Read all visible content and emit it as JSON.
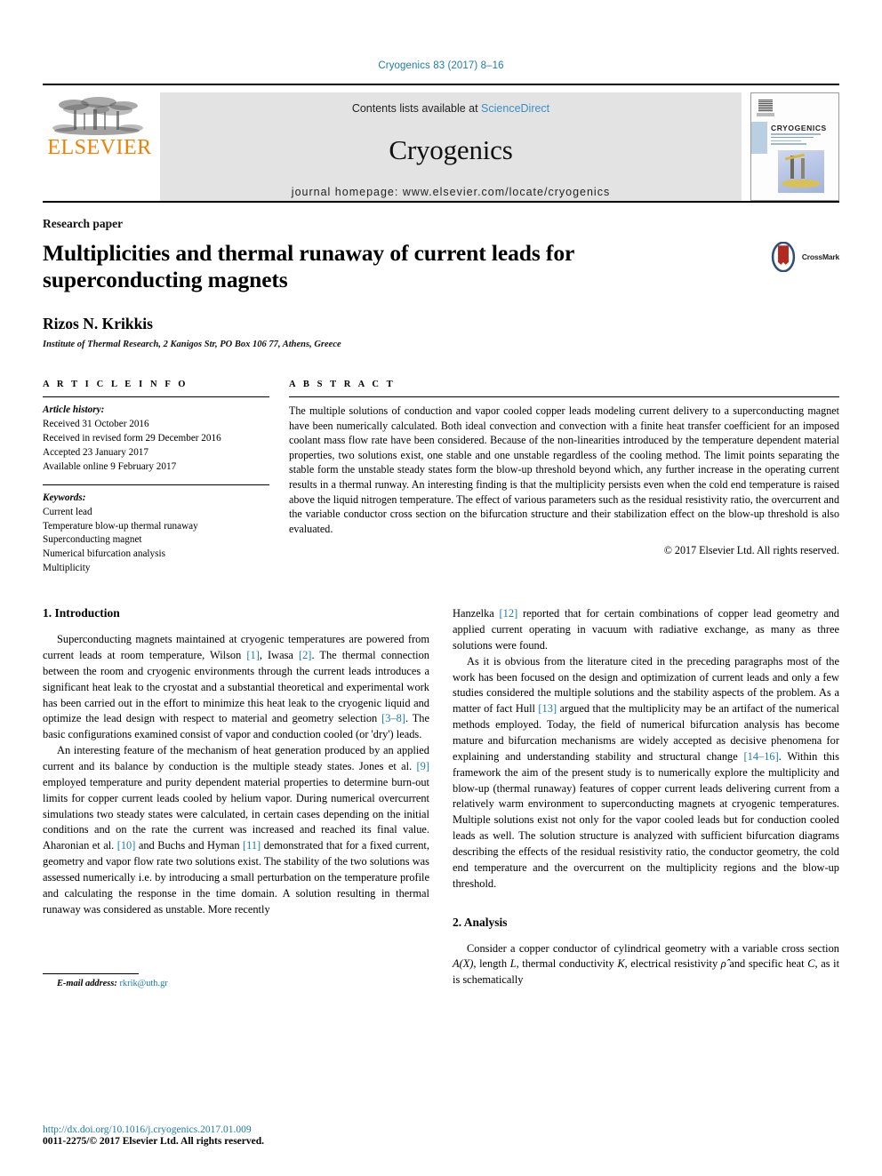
{
  "running_head": "Cryogenics 83 (2017) 8–16",
  "masthead": {
    "publisher": "ELSEVIER",
    "contents_prefix": "Contents lists available at ",
    "contents_link": "ScienceDirect",
    "journal_title": "Cryogenics",
    "homepage": "journal homepage: www.elsevier.com/locate/cryogenics",
    "cover_name": "CRYOGENICS"
  },
  "article": {
    "kicker": "Research paper",
    "title": "Multiplicities and thermal runaway of current leads for superconducting magnets",
    "crossmark_label": "CrossMark",
    "author": "Rizos N. Krikkis",
    "affiliation": "Institute of Thermal Research, 2 Kanigos Str, PO Box 106 77, Athens, Greece"
  },
  "info": {
    "heading": "A R T I C L E    I N F O",
    "history_label": "Article history:",
    "history": [
      "Received 31 October 2016",
      "Received in revised form 29 December 2016",
      "Accepted 23 January 2017",
      "Available online 9 February 2017"
    ],
    "keywords_label": "Keywords:",
    "keywords": [
      "Current lead",
      "Temperature blow-up thermal runaway",
      "Superconducting magnet",
      "Numerical bifurcation analysis",
      "Multiplicity"
    ]
  },
  "abstract": {
    "heading": "A B S T R A C T",
    "text": "The multiple solutions of conduction and vapor cooled copper leads modeling current delivery to a superconducting magnet have been numerically calculated. Both ideal convection and convection with a finite heat transfer coefficient for an imposed coolant mass flow rate have been considered. Because of the non-linearities introduced by the temperature dependent material properties, two solutions exist, one stable and one unstable regardless of the cooling method. The limit points separating the stable form the unstable steady states form the blow-up threshold beyond which, any further increase in the operating current results in a thermal runway. An interesting finding is that the multiplicity persists even when the cold end temperature is raised above the liquid nitrogen temperature. The effect of various parameters such as the residual resistivity ratio, the overcurrent and the variable conductor cross section on the bifurcation structure and their stabilization effect on the blow-up threshold is also evaluated.",
    "copyright": "© 2017 Elsevier Ltd. All rights reserved."
  },
  "sections": {
    "intro_heading": "1. Introduction",
    "analysis_heading": "2. Analysis"
  },
  "paragraphs": {
    "left_1_a": "Superconducting magnets maintained at cryogenic temperatures are powered from current leads at room temperature, Wilson ",
    "left_1_ref1": "[1]",
    "left_1_b": ", Iwasa ",
    "left_1_ref2": "[2]",
    "left_1_c": ". The thermal connection between the room and cryogenic environments through the current leads introduces a significant heat leak to the cryostat and a substantial theoretical and experimental work has been carried out in the effort to minimize this heat leak to the cryogenic liquid and optimize the lead design with respect to material and geometry selection ",
    "left_1_ref3": "[3–8]",
    "left_1_d": ". The basic configurations examined consist of vapor and conduction cooled (or 'dry') leads.",
    "left_2_a": "An interesting feature of the mechanism of heat generation produced by an applied current and its balance by conduction is the multiple steady states. Jones et al. ",
    "left_2_ref1": "[9]",
    "left_2_b": " employed temperature and purity dependent material properties to determine burn-out limits for copper current leads cooled by helium vapor. During numerical overcurrent simulations two steady states were calculated, in certain cases depending on the initial conditions and on the rate the current was increased and reached its final value. Aharonian et al. ",
    "left_2_ref2": "[10]",
    "left_2_c": " and Buchs and Hyman ",
    "left_2_ref3": "[11]",
    "left_2_d": " demonstrated that for a fixed current, geometry and vapor flow rate two solutions exist. The stability of the two solutions was assessed numerically i.e. by introducing a small perturbation on the temperature profile and calculating the response in the time domain. A solution resulting in thermal runaway was considered as unstable. More recently",
    "right_1_a": "Hanzelka ",
    "right_1_ref1": "[12]",
    "right_1_b": " reported that for certain combinations of copper lead geometry and applied current operating in vacuum with radiative exchange, as many as three solutions were found.",
    "right_2_a": "As it is obvious from the literature cited in the preceding paragraphs most of the work has been focused on the design and optimization of current leads and only a few studies considered the multiple solutions and the stability aspects of the problem. As a matter of fact Hull ",
    "right_2_ref1": "[13]",
    "right_2_b": " argued that the multiplicity may be an artifact of the numerical methods employed. Today, the field of numerical bifurcation analysis has become mature and bifurcation mechanisms are widely accepted as decisive phenomena for explaining and understanding stability and structural change ",
    "right_2_ref2": "[14–16]",
    "right_2_c": ". Within this framework the aim of the present study is to numerically explore the multiplicity and blow-up (thermal runaway) features of copper current leads delivering current from a relatively warm environment to superconducting magnets at cryogenic temperatures. Multiple solutions exist not only for the vapor cooled leads but for conduction cooled leads as well. The solution structure is analyzed with sufficient bifurcation diagrams describing the effects of the residual resistivity ratio, the conductor geometry, the cold end temperature and the overcurrent on the multiplicity regions and the blow-up threshold.",
    "right_3_a": "Consider a copper conductor of cylindrical geometry with a variable cross section ",
    "right_3_ax": "A(X)",
    "right_3_b": ", length ",
    "right_3_l": "L",
    "right_3_c": ", thermal conductivity ",
    "right_3_k": "K",
    "right_3_d": ", electrical resistivity ",
    "right_3_rho": "ρ̂",
    "right_3_e": " and specific heat ",
    "right_3_cc": "C",
    "right_3_f": ", as it is schematically"
  },
  "footnote": {
    "label": "E-mail address:",
    "email": "rkrik@uth.gr"
  },
  "footer": {
    "doi": "http://dx.doi.org/10.1016/j.cryogenics.2017.01.009",
    "issn": "0011-2275/© 2017 Elsevier Ltd. All rights reserved."
  },
  "colors": {
    "link": "#1a7ca8",
    "sciencedirect": "#3a8fc8",
    "elsevier_orange": "#F08000",
    "band_gray": "#e3e3e3",
    "crossmark_red": "#b1291f"
  }
}
